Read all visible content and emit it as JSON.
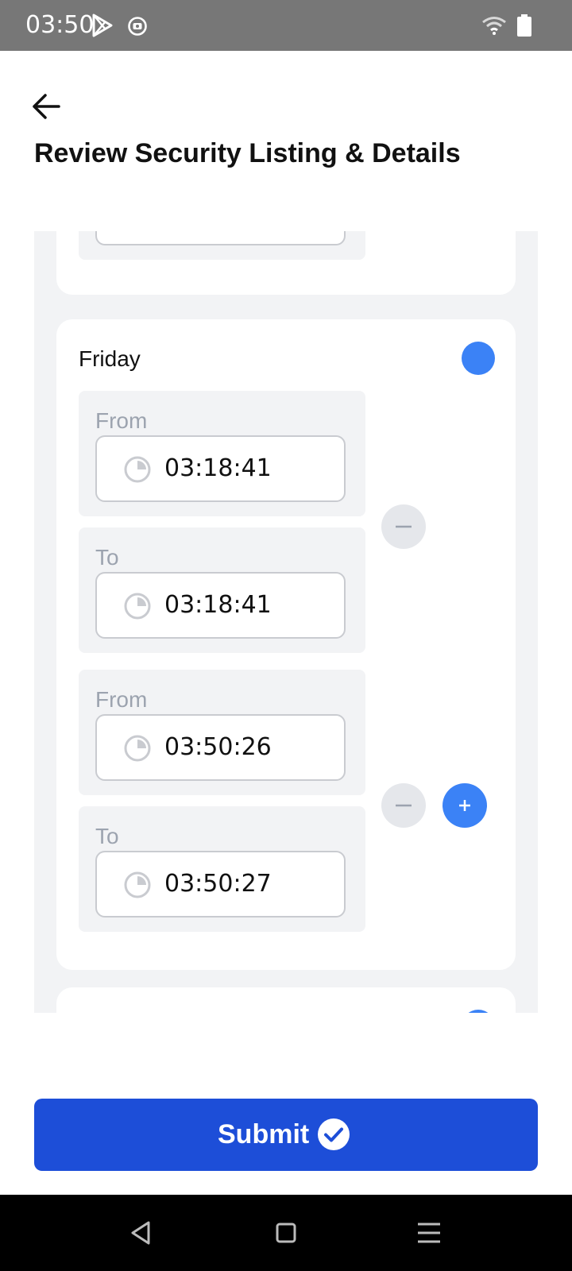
{
  "status_bar": {
    "time": "03:50",
    "icons": [
      "play-store-icon",
      "record-icon",
      "wifi-icon",
      "battery-icon"
    ]
  },
  "header": {
    "title": "Review Security Listing & Details",
    "back_icon": "arrow-left-icon"
  },
  "schedule": {
    "day": "Friday",
    "day_enabled": true,
    "slots": [
      {
        "from_label": "From",
        "from_value": "03:18:41",
        "to_label": "To",
        "to_value": "03:18:41"
      },
      {
        "from_label": "From",
        "from_value": "03:50:26",
        "to_label": "To",
        "to_value": "03:50:27"
      }
    ]
  },
  "submit": {
    "label": "Submit",
    "icon": "check-circle-icon"
  },
  "colors": {
    "accent": "#3b82f6",
    "submit": "#1d4ed8",
    "panel_bg": "#f2f3f5",
    "muted_label": "#9ca3af",
    "status_bar": "#777777"
  },
  "nav_bar": {
    "icons": [
      "back-triangle-icon",
      "home-square-icon",
      "menu-lines-icon"
    ]
  }
}
